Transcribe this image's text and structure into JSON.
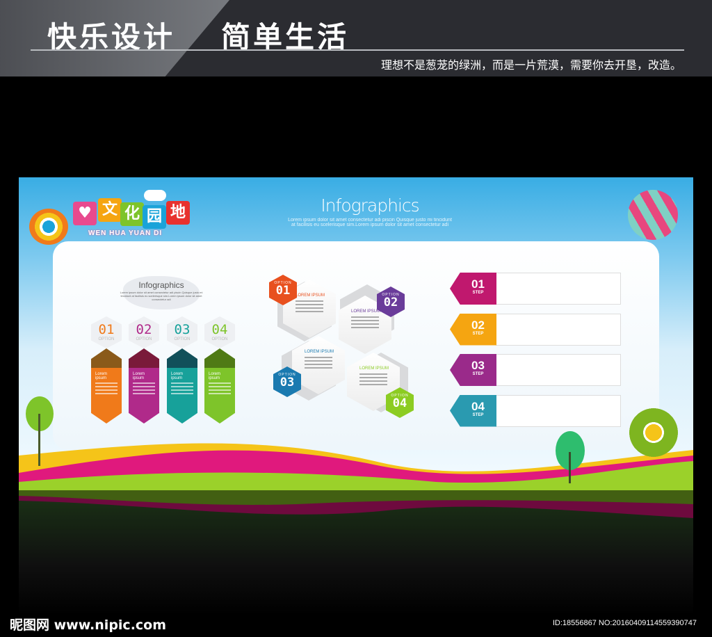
{
  "header": {
    "title_left": "快乐设计",
    "title_right": "简单生活",
    "slogan": "理想不是葱茏的绿洲，而是一片荒漠，需要你去开垦，改造。"
  },
  "poster": {
    "logo": {
      "chars": [
        "文",
        "化",
        "园",
        "地"
      ],
      "pinyin": "WEN HUA YUAN DI"
    },
    "title": "Infographics",
    "subtitle": "Lorem ipsum dolor sit amet consectetur adi piscin Quisque justo mi tincidunt at facilisis eu scelerisque sim.Lorem ipsum dolor sit amet consectetur adi",
    "columns_title": "Infographics",
    "columns_subtitle": "Lorem ipsum dolor sit amet consectetur adi piscin Quisque justo mi tincidunt at facilisis eu scelerisque sim.Lorem ipsum dolor sit amet consectetur adi",
    "columns": [
      {
        "num": "01",
        "label": "OPTION",
        "heading": "Lorem ipsum",
        "color": "#f07a1a",
        "top": "#8a5a1a"
      },
      {
        "num": "02",
        "label": "OPTION",
        "heading": "Lorem ipsum",
        "color": "#b02a8a",
        "top": "#7a1a3a"
      },
      {
        "num": "03",
        "label": "OPTION",
        "heading": "Lorem ipsum",
        "color": "#17a19a",
        "top": "#11505a"
      },
      {
        "num": "04",
        "label": "OPTION",
        "heading": "Lorem ipsum",
        "color": "#7ec42a",
        "top": "#4f7a15"
      }
    ],
    "options": [
      {
        "label": "OPTION",
        "num": "01",
        "heading": "LOREM IPSUM",
        "color": "#e8501e"
      },
      {
        "label": "OPTION",
        "num": "02",
        "heading": "LOREM IPSUM",
        "color": "#6a3c9a"
      },
      {
        "label": "OPTION",
        "num": "03",
        "heading": "LOREM IPSUM",
        "color": "#1a7ab0"
      },
      {
        "label": "OPTION",
        "num": "04",
        "heading": "LOREM IPSUM",
        "color": "#8ccc22"
      }
    ],
    "steps": [
      {
        "num": "01",
        "label": "STEP",
        "color": "#c0186e"
      },
      {
        "num": "02",
        "label": "STEP",
        "color": "#f5a511"
      },
      {
        "num": "03",
        "label": "STEP",
        "color": "#9a2a8a"
      },
      {
        "num": "04",
        "label": "STEP",
        "color": "#2a9ab0"
      }
    ]
  },
  "footer": {
    "watermark": "昵图网 www.nipic.com",
    "id": "ID:18556867 NO:20160409114559390747"
  }
}
